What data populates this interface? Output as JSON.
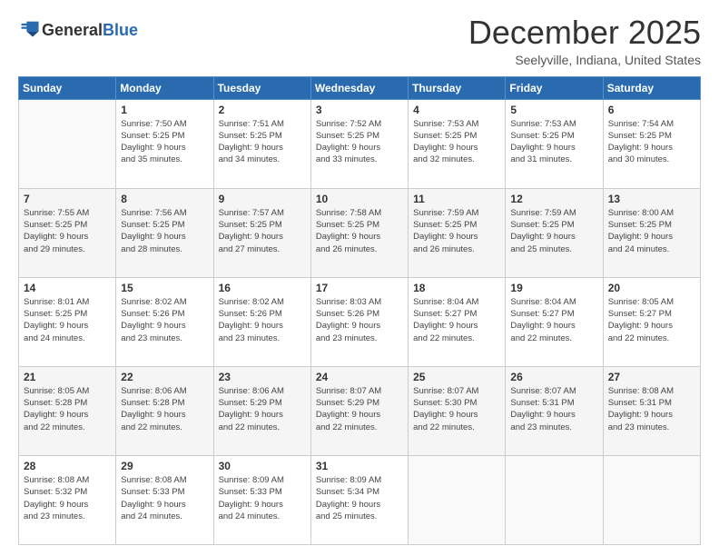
{
  "logo": {
    "general": "General",
    "blue": "Blue"
  },
  "title": "December 2025",
  "subtitle": "Seelyville, Indiana, United States",
  "days_header": [
    "Sunday",
    "Monday",
    "Tuesday",
    "Wednesday",
    "Thursday",
    "Friday",
    "Saturday"
  ],
  "weeks": [
    [
      {
        "day": "",
        "info": ""
      },
      {
        "day": "1",
        "info": "Sunrise: 7:50 AM\nSunset: 5:25 PM\nDaylight: 9 hours\nand 35 minutes."
      },
      {
        "day": "2",
        "info": "Sunrise: 7:51 AM\nSunset: 5:25 PM\nDaylight: 9 hours\nand 34 minutes."
      },
      {
        "day": "3",
        "info": "Sunrise: 7:52 AM\nSunset: 5:25 PM\nDaylight: 9 hours\nand 33 minutes."
      },
      {
        "day": "4",
        "info": "Sunrise: 7:53 AM\nSunset: 5:25 PM\nDaylight: 9 hours\nand 32 minutes."
      },
      {
        "day": "5",
        "info": "Sunrise: 7:53 AM\nSunset: 5:25 PM\nDaylight: 9 hours\nand 31 minutes."
      },
      {
        "day": "6",
        "info": "Sunrise: 7:54 AM\nSunset: 5:25 PM\nDaylight: 9 hours\nand 30 minutes."
      }
    ],
    [
      {
        "day": "7",
        "info": "Sunrise: 7:55 AM\nSunset: 5:25 PM\nDaylight: 9 hours\nand 29 minutes."
      },
      {
        "day": "8",
        "info": "Sunrise: 7:56 AM\nSunset: 5:25 PM\nDaylight: 9 hours\nand 28 minutes."
      },
      {
        "day": "9",
        "info": "Sunrise: 7:57 AM\nSunset: 5:25 PM\nDaylight: 9 hours\nand 27 minutes."
      },
      {
        "day": "10",
        "info": "Sunrise: 7:58 AM\nSunset: 5:25 PM\nDaylight: 9 hours\nand 26 minutes."
      },
      {
        "day": "11",
        "info": "Sunrise: 7:59 AM\nSunset: 5:25 PM\nDaylight: 9 hours\nand 26 minutes."
      },
      {
        "day": "12",
        "info": "Sunrise: 7:59 AM\nSunset: 5:25 PM\nDaylight: 9 hours\nand 25 minutes."
      },
      {
        "day": "13",
        "info": "Sunrise: 8:00 AM\nSunset: 5:25 PM\nDaylight: 9 hours\nand 24 minutes."
      }
    ],
    [
      {
        "day": "14",
        "info": "Sunrise: 8:01 AM\nSunset: 5:25 PM\nDaylight: 9 hours\nand 24 minutes."
      },
      {
        "day": "15",
        "info": "Sunrise: 8:02 AM\nSunset: 5:26 PM\nDaylight: 9 hours\nand 23 minutes."
      },
      {
        "day": "16",
        "info": "Sunrise: 8:02 AM\nSunset: 5:26 PM\nDaylight: 9 hours\nand 23 minutes."
      },
      {
        "day": "17",
        "info": "Sunrise: 8:03 AM\nSunset: 5:26 PM\nDaylight: 9 hours\nand 23 minutes."
      },
      {
        "day": "18",
        "info": "Sunrise: 8:04 AM\nSunset: 5:27 PM\nDaylight: 9 hours\nand 22 minutes."
      },
      {
        "day": "19",
        "info": "Sunrise: 8:04 AM\nSunset: 5:27 PM\nDaylight: 9 hours\nand 22 minutes."
      },
      {
        "day": "20",
        "info": "Sunrise: 8:05 AM\nSunset: 5:27 PM\nDaylight: 9 hours\nand 22 minutes."
      }
    ],
    [
      {
        "day": "21",
        "info": "Sunrise: 8:05 AM\nSunset: 5:28 PM\nDaylight: 9 hours\nand 22 minutes."
      },
      {
        "day": "22",
        "info": "Sunrise: 8:06 AM\nSunset: 5:28 PM\nDaylight: 9 hours\nand 22 minutes."
      },
      {
        "day": "23",
        "info": "Sunrise: 8:06 AM\nSunset: 5:29 PM\nDaylight: 9 hours\nand 22 minutes."
      },
      {
        "day": "24",
        "info": "Sunrise: 8:07 AM\nSunset: 5:29 PM\nDaylight: 9 hours\nand 22 minutes."
      },
      {
        "day": "25",
        "info": "Sunrise: 8:07 AM\nSunset: 5:30 PM\nDaylight: 9 hours\nand 22 minutes."
      },
      {
        "day": "26",
        "info": "Sunrise: 8:07 AM\nSunset: 5:31 PM\nDaylight: 9 hours\nand 23 minutes."
      },
      {
        "day": "27",
        "info": "Sunrise: 8:08 AM\nSunset: 5:31 PM\nDaylight: 9 hours\nand 23 minutes."
      }
    ],
    [
      {
        "day": "28",
        "info": "Sunrise: 8:08 AM\nSunset: 5:32 PM\nDaylight: 9 hours\nand 23 minutes."
      },
      {
        "day": "29",
        "info": "Sunrise: 8:08 AM\nSunset: 5:33 PM\nDaylight: 9 hours\nand 24 minutes."
      },
      {
        "day": "30",
        "info": "Sunrise: 8:09 AM\nSunset: 5:33 PM\nDaylight: 9 hours\nand 24 minutes."
      },
      {
        "day": "31",
        "info": "Sunrise: 8:09 AM\nSunset: 5:34 PM\nDaylight: 9 hours\nand 25 minutes."
      },
      {
        "day": "",
        "info": ""
      },
      {
        "day": "",
        "info": ""
      },
      {
        "day": "",
        "info": ""
      }
    ]
  ]
}
